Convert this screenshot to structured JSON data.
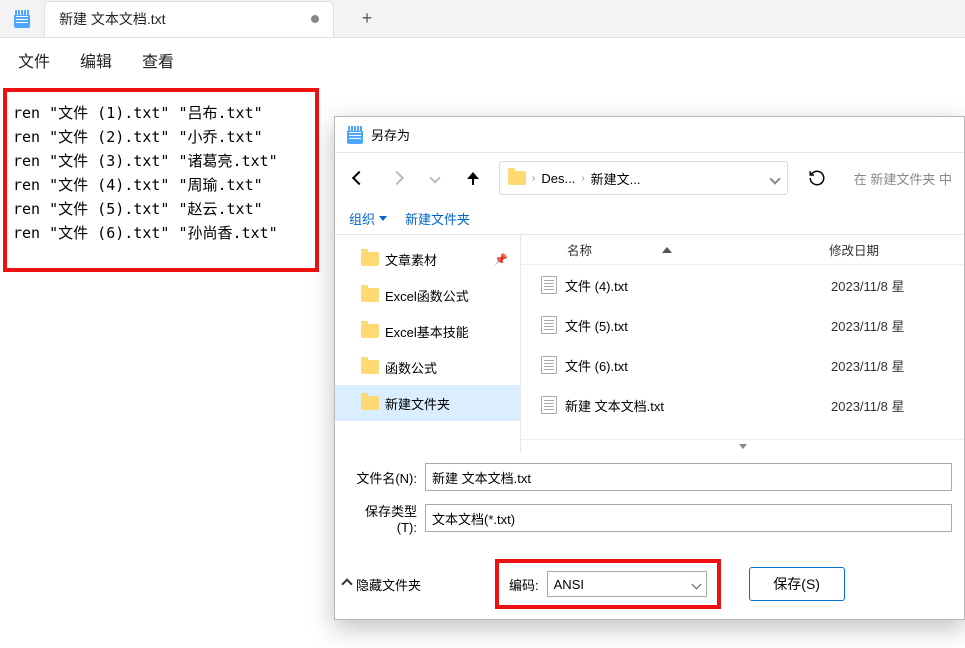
{
  "tab": {
    "title": "新建 文本文档.txt"
  },
  "menu": {
    "file": "文件",
    "edit": "编辑",
    "view": "查看"
  },
  "editor_lines": [
    "ren \"文件 (1).txt\" \"吕布.txt\"",
    "ren \"文件 (2).txt\" \"小乔.txt\"",
    "ren \"文件 (3).txt\" \"诸葛亮.txt\"",
    "ren \"文件 (4).txt\" \"周瑜.txt\"",
    "ren \"文件 (5).txt\" \"赵云.txt\"",
    "ren \"文件 (6).txt\" \"孙尚香.txt\""
  ],
  "dialog": {
    "title": "另存为",
    "breadcrumb": [
      "Des...",
      "新建文..."
    ],
    "search_placeholder": "在 新建文件夹 中",
    "toolbar": {
      "organize": "组织",
      "new_folder": "新建文件夹"
    },
    "tree": [
      {
        "label": "文章素材",
        "pinned": true,
        "selected": false
      },
      {
        "label": "Excel函数公式",
        "pinned": false,
        "selected": false
      },
      {
        "label": "Excel基本技能",
        "pinned": false,
        "selected": false
      },
      {
        "label": "函数公式",
        "pinned": false,
        "selected": false
      },
      {
        "label": "新建文件夹",
        "pinned": false,
        "selected": true
      }
    ],
    "file_header": {
      "name": "名称",
      "date": "修改日期"
    },
    "files": [
      {
        "name": "文件 (4).txt",
        "date": "2023/11/8 星"
      },
      {
        "name": "文件 (5).txt",
        "date": "2023/11/8 星"
      },
      {
        "name": "文件 (6).txt",
        "date": "2023/11/8 星"
      },
      {
        "name": "新建 文本文档.txt",
        "date": "2023/11/8 星"
      }
    ],
    "filename_label": "文件名(N):",
    "filename_value": "新建 文本文档.txt",
    "filetype_label": "保存类型(T):",
    "filetype_value": "文本文档(*.txt)",
    "hide_folders": "隐藏文件夹",
    "encoding_label": "编码:",
    "encoding_value": "ANSI",
    "save_button": "保存(S)"
  }
}
